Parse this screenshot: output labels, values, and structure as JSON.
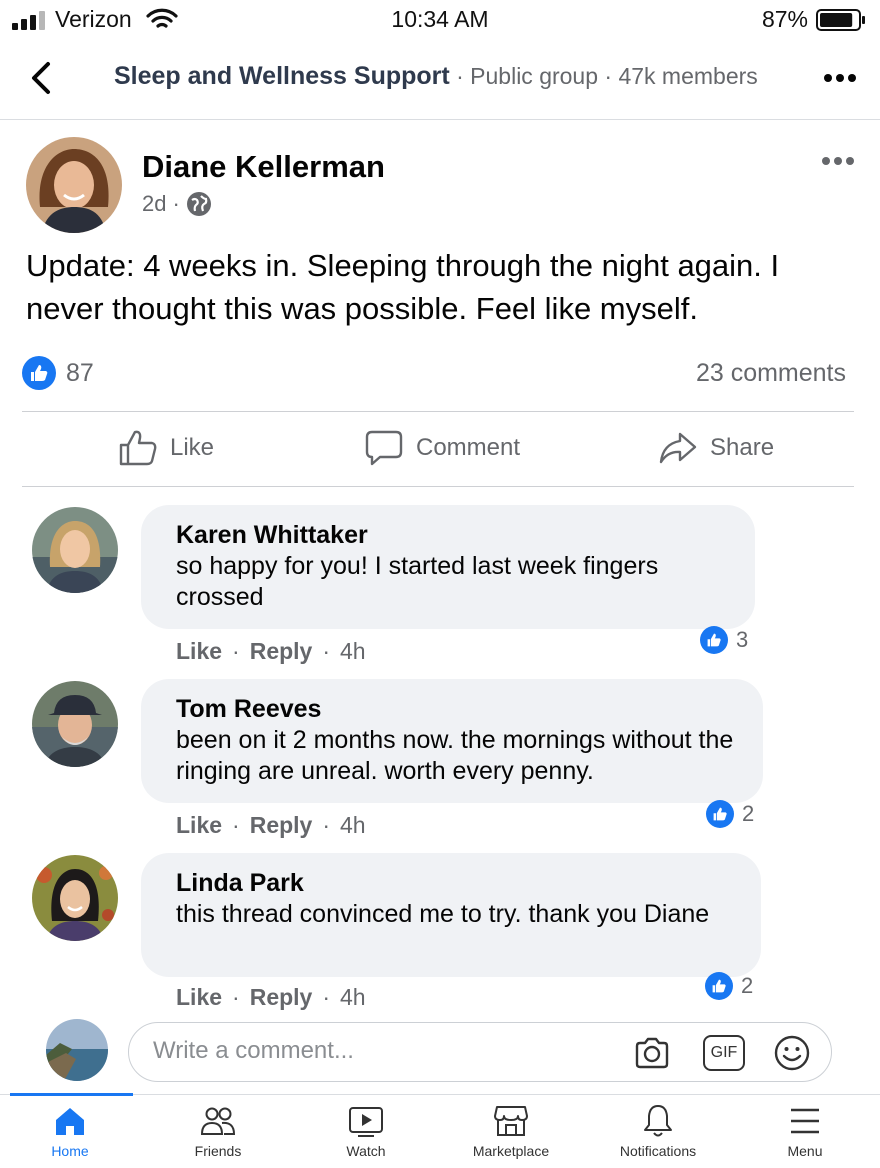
{
  "status_bar": {
    "carrier": "Verizon",
    "time": "10:34 AM",
    "battery_percent": "87%",
    "battery_level": 0.87
  },
  "header": {
    "group_name": "Sleep and Wellness Support",
    "group_meta": " · Public group · 47k members",
    "back_icon": "chevron-left-icon",
    "more_icon": "more-horizontal-icon"
  },
  "post": {
    "author": "Diane Kellerman",
    "time": "2d",
    "separator": "·",
    "audience_icon": "globe-icon",
    "text": "Update: 4 weeks in. Sleeping through the night again. I never thought this was possible. Feel like myself.",
    "like_count": "87",
    "comment_count": "23 comments",
    "actions": {
      "like": "Like",
      "comment": "Comment",
      "share": "Share"
    }
  },
  "comments": [
    {
      "author": "Karen Whittaker",
      "text": "so happy for you! I started last week fingers crossed",
      "like": "Like",
      "reply": "Reply",
      "time": "4h",
      "reactions": "3"
    },
    {
      "author": "Tom Reeves",
      "text": "been on it 2 months now. the mornings without the ringing are unreal. worth every penny.",
      "like": "Like",
      "reply": "Reply",
      "time": "4h",
      "reactions": "2"
    },
    {
      "author": "Linda Park",
      "text": "this thread convinced me to try. thank you Diane",
      "like": "Like",
      "reply": "Reply",
      "time": "4h",
      "reactions": "2"
    }
  ],
  "composer": {
    "placeholder": "Write a comment...",
    "gif_label": "GIF",
    "icons": [
      "camera-icon",
      "gif-icon",
      "emoji-icon"
    ]
  },
  "nav": {
    "items": [
      {
        "label": "Home",
        "icon": "home-icon"
      },
      {
        "label": "Friends",
        "icon": "friends-icon"
      },
      {
        "label": "Watch",
        "icon": "watch-icon"
      },
      {
        "label": "Marketplace",
        "icon": "marketplace-icon"
      },
      {
        "label": "Notifications",
        "icon": "bell-icon"
      },
      {
        "label": "Menu",
        "icon": "menu-icon"
      }
    ],
    "active": "Home"
  },
  "colors": {
    "accent": "#1877f2",
    "bubble": "#f0f2f5",
    "secondary_text": "#65676b",
    "group_name": "#2f3a4d"
  }
}
